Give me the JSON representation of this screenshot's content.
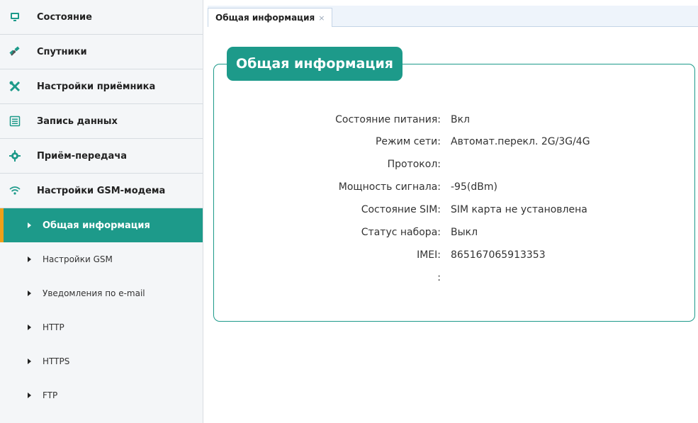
{
  "sidebar": {
    "menu": [
      {
        "label": "Состояние",
        "icon": "monitor-icon"
      },
      {
        "label": "Спутники",
        "icon": "satellite-icon"
      },
      {
        "label": "Настройки приёмника",
        "icon": "tools-icon"
      },
      {
        "label": "Запись данных",
        "icon": "list-icon"
      },
      {
        "label": "Приём-передача",
        "icon": "gear-icon"
      },
      {
        "label": "Настройки GSM-модема",
        "icon": "wifi-icon"
      }
    ],
    "submenu": [
      {
        "label": "Общая информация",
        "active": true
      },
      {
        "label": "Настройки GSM"
      },
      {
        "label": "Уведомления по e-mail"
      },
      {
        "label": "HTTP"
      },
      {
        "label": "HTTPS"
      },
      {
        "label": "FTP"
      }
    ]
  },
  "tabs": [
    {
      "label": "Общая информация",
      "close": "×"
    }
  ],
  "panel": {
    "title": "Общая информация",
    "rows": [
      {
        "key": "Состояние питания:",
        "value": "Вкл"
      },
      {
        "key": "Режим сети:",
        "value": "Автомат.перекл. 2G/3G/4G"
      },
      {
        "key": "Протокол:",
        "value": ""
      },
      {
        "key": "Мощность сигнала:",
        "value": "-95(dBm)"
      },
      {
        "key": "Состояние SIM:",
        "value": "SIM карта не установлена"
      },
      {
        "key": "Статус набора:",
        "value": "Выкл"
      },
      {
        "key": "IMEI:",
        "value": "865167065913353"
      },
      {
        "key": ":",
        "value": ""
      }
    ]
  },
  "colors": {
    "accent": "#1d9a8a",
    "active_marker": "#f0a018"
  }
}
